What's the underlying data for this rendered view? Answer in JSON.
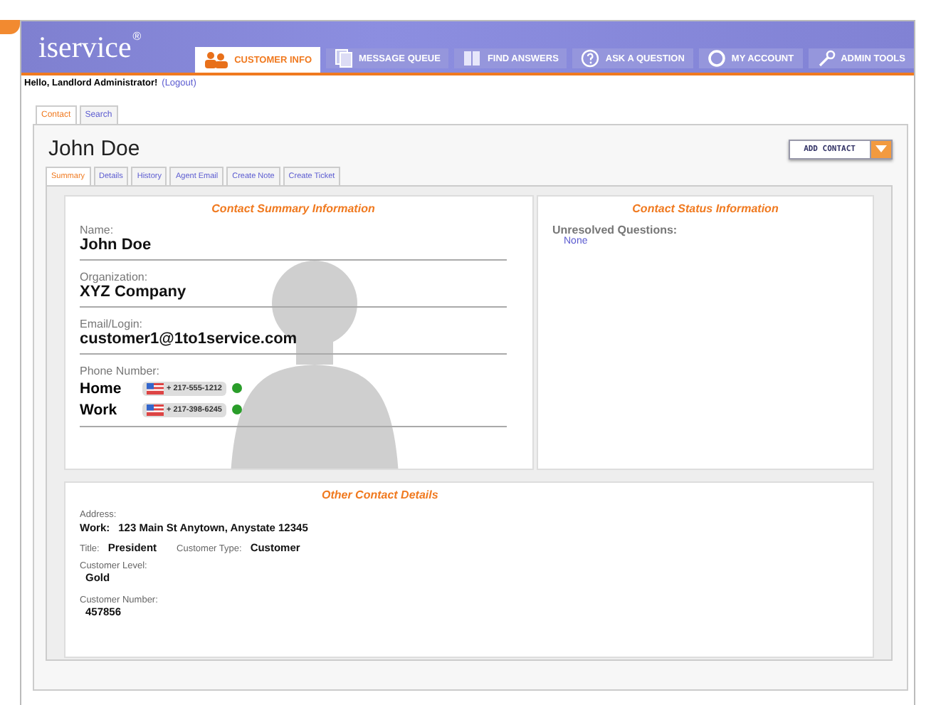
{
  "header": {
    "logo": "iservice",
    "logo_mark": "®"
  },
  "nav": [
    {
      "label": "CUSTOMER INFO",
      "kind": "person",
      "selected": true
    },
    {
      "label": "MESSAGE QUEUE",
      "kind": "pages",
      "selected": false
    },
    {
      "label": "FIND ANSWERS",
      "kind": "book",
      "selected": false
    },
    {
      "label": "ASK A QUESTION",
      "kind": "question",
      "selected": false
    },
    {
      "label": "MY ACCOUNT",
      "kind": "ring",
      "selected": false
    },
    {
      "label": "ADMIN TOOLS",
      "kind": "wrench",
      "selected": false
    }
  ],
  "greeting": {
    "text": "Hello, Landlord Administrator!",
    "logout": "(Logout)"
  },
  "page_tabs": [
    {
      "label": "Contact",
      "selected": true
    },
    {
      "label": "Search",
      "selected": false
    }
  ],
  "contact": {
    "name": "John Doe",
    "add_button": "ADD CONTACT"
  },
  "sub_tabs": [
    {
      "label": "Summary",
      "selected": true
    },
    {
      "label": "Details",
      "selected": false
    },
    {
      "label": "History",
      "selected": false
    },
    {
      "label": "Agent Email",
      "selected": false
    },
    {
      "label": "Create Note",
      "selected": false
    },
    {
      "label": "Create Ticket",
      "selected": false
    }
  ],
  "summary": {
    "title": "Contact Summary Information",
    "fields": [
      {
        "label": "Name:",
        "value": "John Doe"
      },
      {
        "label": "Organization:",
        "value": "XYZ Company"
      },
      {
        "label": "Email/Login:",
        "value": "customer1@1to1service.com"
      }
    ],
    "phone": {
      "label": "Phone Number:",
      "numbers": [
        {
          "type": "Home",
          "number": "+ 217-555-1212"
        },
        {
          "type": "Work",
          "number": "+ 217-398-6245"
        }
      ]
    }
  },
  "status": {
    "title": "Contact Status Information",
    "label": "Unresolved Questions:",
    "value": "None"
  },
  "other": {
    "title": "Other Contact Details",
    "address_label": "Address:",
    "address_type": "Work:",
    "address": "123 Main St Anytown, Anystate 12345",
    "title_label": "Title:",
    "title_value": "President",
    "type_label": "Customer Type:",
    "type_value": "Customer",
    "level_label": "Customer Level:",
    "level_value": "Gold",
    "number_label": "Customer Number:",
    "number_value": "457856"
  }
}
